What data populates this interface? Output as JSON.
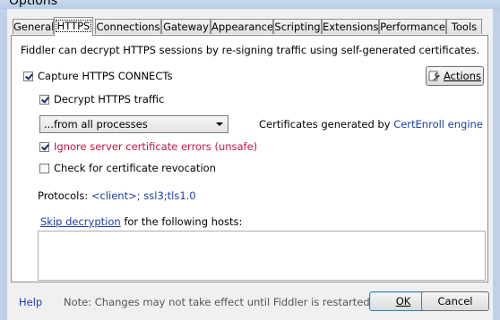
{
  "window": {
    "title": "Options"
  },
  "tabs": [
    {
      "label": "General"
    },
    {
      "label": "HTTPS"
    },
    {
      "label": "Connections"
    },
    {
      "label": "Gateway"
    },
    {
      "label": "Appearance"
    },
    {
      "label": "Scripting"
    },
    {
      "label": "Extensions"
    },
    {
      "label": "Performance"
    },
    {
      "label": "Tools"
    }
  ],
  "active_tab": "HTTPS",
  "https": {
    "description": "Fiddler can decrypt HTTPS sessions by re-signing traffic using self-generated certificates.",
    "capture_label": "Capture HTTPS CONNECTs",
    "capture_checked": true,
    "actions_label": "Actions",
    "decrypt_label": "Decrypt HTTPS traffic",
    "decrypt_checked": true,
    "process_filter": "...from all processes",
    "certs_prefix": "Certificates generated by ",
    "certs_engine": "CertEnroll engine",
    "ignore_errors_label": "Ignore server certificate errors (unsafe)",
    "ignore_errors_checked": true,
    "revocation_label": "Check for certificate revocation",
    "revocation_checked": false,
    "protocols_label": "Protocols: ",
    "protocols_value": "<client>; ssl3;tls1.0",
    "skip_link": "Skip decryption",
    "skip_rest": " for the following hosts:",
    "hosts_value": ""
  },
  "footer": {
    "help_label": "Help",
    "note": "Note: Changes may not take effect until Fiddler is restarted.",
    "ok_label": "OK",
    "cancel_label": "Cancel"
  },
  "colors": {
    "link": "#1a3ea8",
    "warning": "#c0163c",
    "frame": "#bfd0e8"
  },
  "icons": [
    "wrench-icon",
    "dropdown-arrow-icon",
    "checkmark-icon"
  ]
}
